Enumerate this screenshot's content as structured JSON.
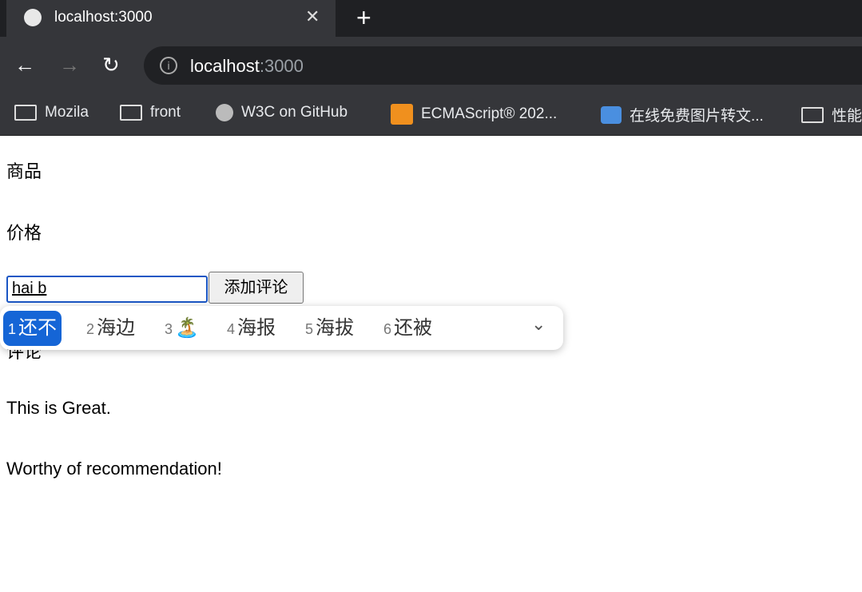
{
  "browser": {
    "tab_title": "localhost:3000",
    "url_host": "localhost",
    "url_port": ":3000",
    "bookmarks": [
      {
        "label": "Mozila",
        "icon": "folder-icon"
      },
      {
        "label": "front",
        "icon": "folder-icon"
      },
      {
        "label": "W3C on GitHub",
        "icon": "globe-icon"
      },
      {
        "label": "ECMAScript® 202...",
        "icon": "ecma-icon"
      },
      {
        "label": "在线免费图片转文...",
        "icon": "image-icon"
      },
      {
        "label": "性能",
        "icon": "folder-icon"
      }
    ]
  },
  "page": {
    "product_label": "商品",
    "price_label": "价格",
    "comment_input_value": "hai b",
    "add_comment_button": "添加评论",
    "comments_heading": "评论",
    "comments": [
      "This is Great.",
      "Worthy of recommendation!"
    ]
  },
  "ime": {
    "candidates": [
      {
        "num": "1",
        "text": "还不",
        "selected": true
      },
      {
        "num": "2",
        "text": "海边"
      },
      {
        "num": "3",
        "text": "🏝️"
      },
      {
        "num": "4",
        "text": "海报"
      },
      {
        "num": "5",
        "text": "海拔"
      },
      {
        "num": "6",
        "text": "还被"
      }
    ],
    "selected_color": "#1565d6"
  }
}
